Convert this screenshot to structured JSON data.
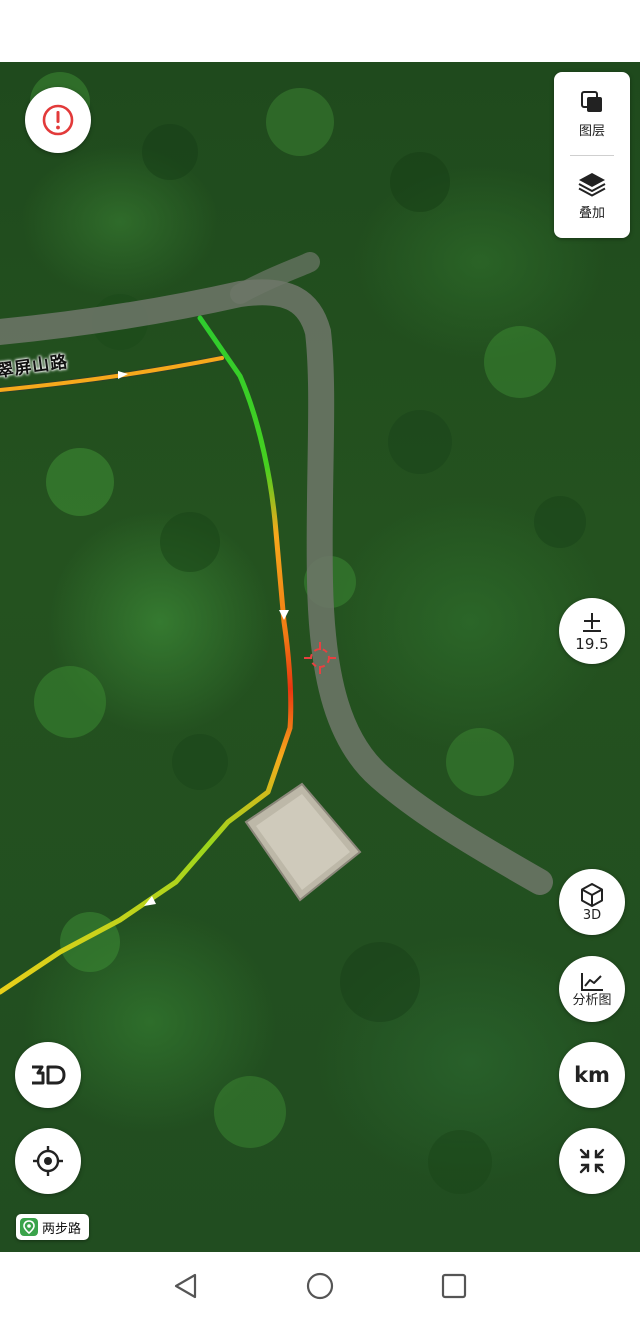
{
  "map": {
    "road_label": "翠屏山路",
    "layer_panel": {
      "layers_label": "图层",
      "overlay_label": "叠加"
    },
    "zoom": {
      "icon": "plus-icon",
      "level": "19.5"
    },
    "right_controls": {
      "view_3d_label": "3D",
      "analysis_label": "分析图",
      "unit_label": "km"
    },
    "left_controls": {
      "alert_icon": "alert-icon",
      "mode_3d_icon": "3d-mode-icon",
      "locate_icon": "locate-icon"
    },
    "badge_label": "两步路",
    "track_colors": {
      "slow": "#e8360f",
      "medium": "#f6a91c",
      "fast": "#2ecc2e"
    }
  },
  "nav": {
    "back_icon": "back-triangle-icon",
    "home_icon": "home-circle-icon",
    "recents_icon": "recents-square-icon"
  }
}
